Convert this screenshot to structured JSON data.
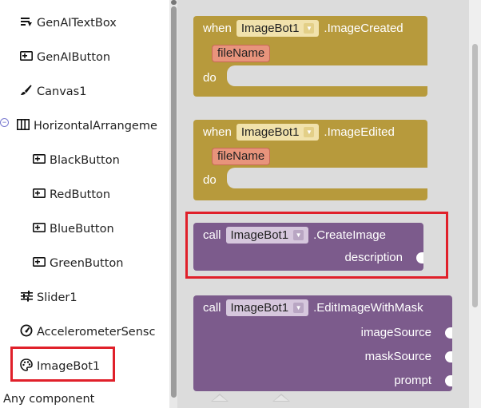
{
  "tree": {
    "items": [
      {
        "label": "GenAITextBox",
        "icon": "text-box-icon"
      },
      {
        "label": "GenAIButton",
        "icon": "button-icon"
      },
      {
        "label": "Canvas1",
        "icon": "paintbrush-icon"
      },
      {
        "label": "HorizontalArrangeme",
        "icon": "horizontal-arrangement-icon"
      },
      {
        "label": "BlackButton",
        "icon": "button-icon"
      },
      {
        "label": "RedButton",
        "icon": "button-icon"
      },
      {
        "label": "BlueButton",
        "icon": "button-icon"
      },
      {
        "label": "GreenButton",
        "icon": "button-icon"
      },
      {
        "label": "Slider1",
        "icon": "slider-icon"
      },
      {
        "label": "AccelerometerSensc",
        "icon": "gauge-icon"
      },
      {
        "label": "ImageBot1",
        "icon": "palette-icon"
      }
    ],
    "any_component": "Any component",
    "collapse_symbol": "−"
  },
  "blocks": {
    "event1": {
      "when": "when",
      "component": "ImageBot1",
      "event": ".ImageCreated",
      "param": "fileName",
      "do": "do"
    },
    "event2": {
      "when": "when",
      "component": "ImageBot1",
      "event": ".ImageEdited",
      "param": "fileName",
      "do": "do"
    },
    "call1": {
      "call": "call",
      "component": "ImageBot1",
      "method": ".CreateImage",
      "args": [
        "description"
      ]
    },
    "call2": {
      "call": "call",
      "component": "ImageBot1",
      "method": ".EditImageWithMask",
      "args": [
        "imageSource",
        "maskSource",
        "prompt"
      ]
    }
  },
  "colors": {
    "event_block": "#b79a3c",
    "call_block": "#7c5b8c",
    "highlight": "#e0202a"
  }
}
